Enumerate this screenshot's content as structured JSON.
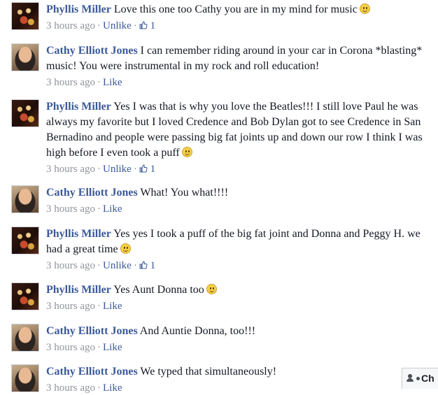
{
  "comments": [
    {
      "author": "Phyllis Miller",
      "text": "Love this one too Cathy you are in my mind for music",
      "smiley": true,
      "time": "3 hours ago",
      "action": "Unlike",
      "likes": "1"
    },
    {
      "author": "Cathy Elliott Jones",
      "text": "I can remember riding around in your car in Corona *blasting* music! You were instrumental in my rock and roll education!",
      "smiley": false,
      "time": "3 hours ago",
      "action": "Like",
      "likes": ""
    },
    {
      "author": "Phyllis Miller",
      "text": "Yes I was that is why you love the Beatles!!! I still love Paul he was always my favorite but I loved Credence and Bob Dylan got to see Credence in San Bernadino and people were passing big fat joints up and down our row I think I was high before I even took a puff",
      "smiley": true,
      "time": "3 hours ago",
      "action": "Unlike",
      "likes": "1"
    },
    {
      "author": "Cathy Elliott Jones",
      "text": "What! You what!!!!",
      "smiley": false,
      "time": "3 hours ago",
      "action": "Like",
      "likes": ""
    },
    {
      "author": "Phyllis Miller",
      "text": "Yes yes I took a puff of the big fat joint and Donna and Peggy H. we had a great time",
      "smiley": true,
      "time": "3 hours ago",
      "action": "Unlike",
      "likes": "1"
    },
    {
      "author": "Phyllis Miller",
      "text": "Yes Aunt Donna too",
      "smiley": true,
      "time": "3 hours ago",
      "action": "Like",
      "likes": ""
    },
    {
      "author": "Cathy Elliott Jones",
      "text": "And Auntie Donna, too!!!",
      "smiley": false,
      "time": "3 hours ago",
      "action": "Like",
      "likes": ""
    },
    {
      "author": "Cathy Elliott Jones",
      "text": "We typed that simultaneously!",
      "smiley": false,
      "time": "3 hours ago",
      "action": "Like",
      "likes": ""
    }
  ],
  "chat_tab": {
    "label": "Ch"
  },
  "icons": {
    "like": "thumbs-up-icon",
    "smiley": "smiley-icon",
    "chat": "people-icon",
    "status": "online-dot-icon"
  }
}
